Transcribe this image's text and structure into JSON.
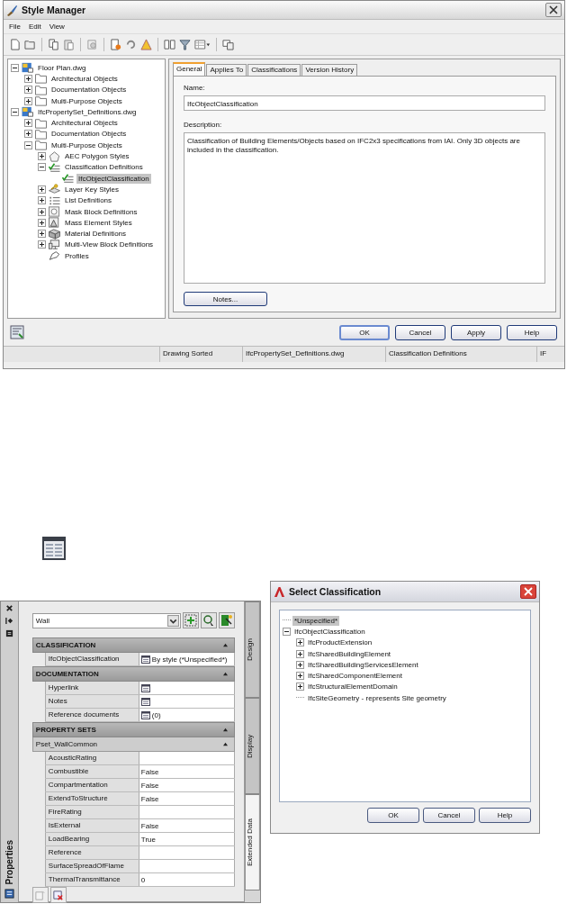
{
  "style_manager": {
    "title": "Style Manager",
    "menu": [
      "File",
      "Edit",
      "View"
    ],
    "tree": [
      {
        "label": "Floor Plan.dwg",
        "kind": "drawing",
        "expanded": true,
        "selected": false,
        "children": [
          {
            "label": "Architectural Objects",
            "kind": "folder",
            "expanded": false,
            "selected": false
          },
          {
            "label": "Documentation Objects",
            "kind": "folder",
            "expanded": false,
            "selected": false
          },
          {
            "label": "Multi-Purpose Objects",
            "kind": "folder",
            "expanded": false,
            "selected": false
          }
        ]
      },
      {
        "label": "IfcPropertySet_Definitions.dwg",
        "kind": "drawing",
        "expanded": true,
        "selected": false,
        "children": [
          {
            "label": "Architectural Objects",
            "kind": "folder",
            "expanded": false,
            "selected": false
          },
          {
            "label": "Documentation Objects",
            "kind": "folder",
            "expanded": false,
            "selected": false
          },
          {
            "label": "Multi-Purpose Objects",
            "kind": "folder",
            "expanded": true,
            "selected": false,
            "children": [
              {
                "label": "AEC Polygon Styles",
                "kind": "polygon",
                "expanded": false,
                "selected": false
              },
              {
                "label": "Classification Definitions",
                "kind": "checklist",
                "expanded": true,
                "selected": false,
                "children": [
                  {
                    "label": "IfcObjectClassification",
                    "kind": "checklist",
                    "selected": true
                  }
                ]
              },
              {
                "label": "Layer Key Styles",
                "kind": "key",
                "expanded": false,
                "selected": false
              },
              {
                "label": "List Definitions",
                "kind": "list",
                "expanded": false,
                "selected": false
              },
              {
                "label": "Mask Block Definitions",
                "kind": "mask",
                "expanded": false,
                "selected": false
              },
              {
                "label": "Mass Element Styles",
                "kind": "mass",
                "expanded": false,
                "selected": false
              },
              {
                "label": "Material Definitions",
                "kind": "material",
                "expanded": false,
                "selected": false
              },
              {
                "label": "Multi-View Block Definitions",
                "kind": "multiview",
                "expanded": false,
                "selected": false
              },
              {
                "label": "Profiles",
                "kind": "profile",
                "selected": false
              }
            ]
          }
        ]
      }
    ],
    "tabs": [
      {
        "label": "General",
        "selected": true
      },
      {
        "label": "Applies To",
        "selected": false
      },
      {
        "label": "Classifications",
        "selected": false
      },
      {
        "label": "Version History",
        "selected": false
      }
    ],
    "name_label": "Name:",
    "name_value": "IfcObjectClassification",
    "description_label": "Description:",
    "description_value": "Classification of Building Elements/Objects based on IFC2x3 specifications from IAI. Only 3D objects are included in the classification.",
    "notes_button": "Notes...",
    "buttons": [
      "OK",
      "Cancel",
      "Apply",
      "Help"
    ],
    "status_bar": [
      "Drawing Sorted",
      "IfcPropertySet_Definitions.dwg",
      "Classification Definitions",
      "IF"
    ]
  },
  "properties_palette": {
    "title": "Properties",
    "object_type": "Wall",
    "side_tabs": [
      {
        "label": "Design",
        "selected": false
      },
      {
        "label": "Display",
        "selected": false
      },
      {
        "label": "Extended Data",
        "selected": true
      }
    ],
    "sections": [
      {
        "title": "CLASSIFICATION",
        "expanded": true,
        "rows": [
          {
            "name": "IfcObjectClassification",
            "value": "By style (*Unspecified*)",
            "button": true
          }
        ]
      },
      {
        "title": "DOCUMENTATION",
        "expanded": true,
        "rows": [
          {
            "name": "Hyperlink",
            "button": true
          },
          {
            "name": "Notes",
            "button": true
          },
          {
            "name": "Reference documents",
            "value": "(0)",
            "button": true
          }
        ]
      },
      {
        "title": "PROPERTY SETS",
        "expanded": true,
        "subsection": {
          "title": "Pset_WallCommon",
          "expanded": true
        },
        "rows": [
          {
            "name": "AcousticRating",
            "button": false
          },
          {
            "name": "Combustible",
            "value": "False",
            "button": false
          },
          {
            "name": "Compartmentation",
            "value": "False",
            "button": false
          },
          {
            "name": "ExtendToStructure",
            "value": "False",
            "button": false
          },
          {
            "name": "FireRating",
            "button": false
          },
          {
            "name": "IsExternal",
            "value": "False",
            "button": false
          },
          {
            "name": "LoadBearing",
            "value": "True",
            "button": false
          },
          {
            "name": "Reference",
            "button": false
          },
          {
            "name": "SurfaceSpreadOfFlame",
            "button": false
          },
          {
            "name": "ThermalTransmittance",
            "value": "0",
            "button": false
          }
        ]
      }
    ]
  },
  "select_classification": {
    "title": "Select Classification",
    "tree": [
      {
        "label": "*Unspecified*",
        "selected": true
      },
      {
        "label": "IfcObjectClassification",
        "expanded": true,
        "selected": false,
        "children": [
          {
            "label": "IfcProductExtension",
            "expanded": false,
            "selected": false
          },
          {
            "label": "IfcSharedBuildingElement",
            "expanded": false,
            "selected": false
          },
          {
            "label": "IfcSharedBuildingServicesElement",
            "expanded": false,
            "selected": false
          },
          {
            "label": "IfcSharedComponentElement",
            "expanded": false,
            "selected": false
          },
          {
            "label": "IfcStructuralElementDomain",
            "expanded": false,
            "selected": false
          },
          {
            "label": "IfcSiteGeometry - represents Site geometry",
            "selected": false
          }
        ]
      }
    ],
    "buttons": [
      "OK",
      "Cancel",
      "Help"
    ]
  }
}
